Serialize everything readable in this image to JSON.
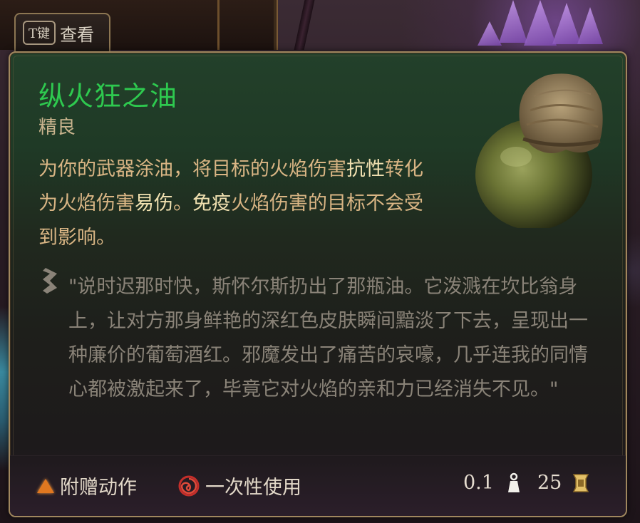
{
  "view_button": {
    "key": "T键",
    "label": "查看"
  },
  "item": {
    "name": "纵火狂之油",
    "rarity": "精良",
    "description_parts": [
      {
        "text": "为你的武器涂油，将目标的火焰伤害",
        "hl": false
      },
      {
        "text": "抗性",
        "hl": true
      },
      {
        "text": "转化为火焰伤害",
        "hl": false
      },
      {
        "text": "易伤",
        "hl": true
      },
      {
        "text": "。",
        "hl": false
      },
      {
        "text": "免疫",
        "hl": true
      },
      {
        "text": "火焰伤害的目标不会受到影响。",
        "hl": false
      }
    ],
    "flavor_text": "\"说时迟那时快，斯怀尔斯扔出了那瓶油。它泼溅在坎比翁身上，让对方那身鲜艳的深红色皮肤瞬间黯淡了下去，呈现出一种廉价的葡萄酒红。邪魔发出了痛苦的哀嚎，几乎连我的同情心都被激起来了，毕竟它对火焰的亲和力已经消失不见。\""
  },
  "footer": {
    "action_type": "附赠动作",
    "usage": "一次性使用",
    "weight": "0.1",
    "value": "25"
  },
  "icons": {
    "action": "bonus-action-triangle-icon",
    "usage": "single-use-swirl-icon",
    "weight": "weight-icon",
    "value": "gold-coin-icon",
    "flavor": "quote-scroll-icon"
  },
  "colors": {
    "name": "#2ec94f",
    "rarity": "#c9b48e",
    "description": "#d9b584",
    "highlight": "#f0e0b0",
    "flavor": "#8a8378",
    "border": "#a0875e"
  }
}
